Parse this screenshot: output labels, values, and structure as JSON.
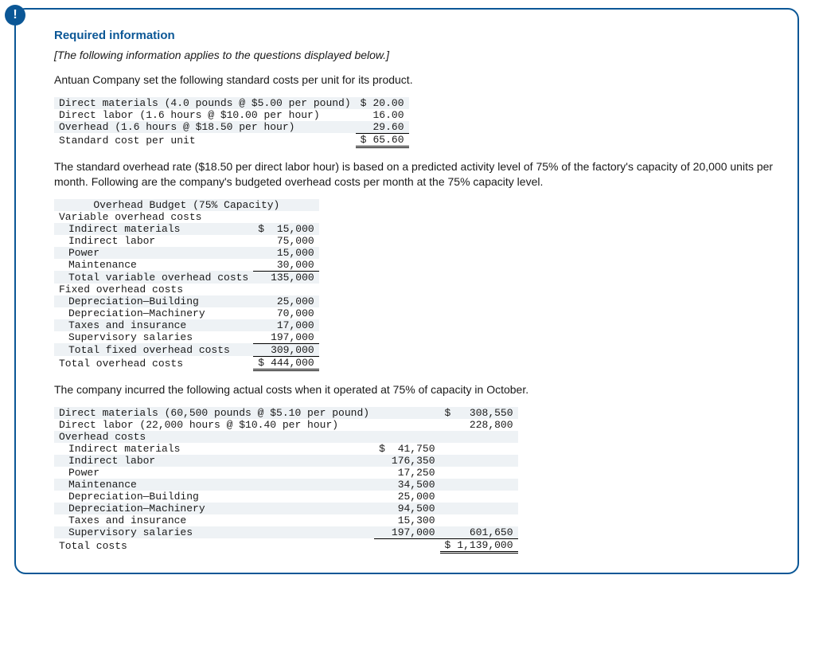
{
  "alert_glyph": "!",
  "title": "Required information",
  "italic_note": "[The following information applies to the questions displayed below.]",
  "intro": "Antuan Company set the following standard costs per unit for its product.",
  "std": {
    "rows": [
      {
        "label": "Direct materials (4.0 pounds @ $5.00 per pound)",
        "cur": "$",
        "val": "20.00"
      },
      {
        "label": "Direct labor (1.6 hours @ $10.00 per hour)",
        "cur": "",
        "val": "16.00"
      },
      {
        "label": "Overhead (1.6 hours @ $18.50 per hour)",
        "cur": "",
        "val": "29.60"
      }
    ],
    "total_label": "Standard cost per unit",
    "total_cur": "$",
    "total_val": "65.60"
  },
  "para2": "The standard overhead rate ($18.50 per direct labor hour) is based on a predicted activity level of 75% of the factory's capacity of 20,000 units per month. Following are the company's budgeted overhead costs per month at the 75% capacity level.",
  "budget": {
    "header": "Overhead Budget (75% Capacity)",
    "var_label": "Variable overhead costs",
    "var_rows": [
      {
        "label": "Indirect materials",
        "cur": "$",
        "val": "15,000"
      },
      {
        "label": "Indirect labor",
        "cur": "",
        "val": "75,000"
      },
      {
        "label": "Power",
        "cur": "",
        "val": "15,000"
      },
      {
        "label": "Maintenance",
        "cur": "",
        "val": "30,000"
      }
    ],
    "var_total_label": "Total variable overhead costs",
    "var_total_val": "135,000",
    "fix_label": "Fixed overhead costs",
    "fix_rows": [
      {
        "label": "Depreciation—Building",
        "val": "25,000"
      },
      {
        "label": "Depreciation—Machinery",
        "val": "70,000"
      },
      {
        "label": "Taxes and insurance",
        "val": "17,000"
      },
      {
        "label": "Supervisory salaries",
        "val": "197,000"
      }
    ],
    "fix_total_label": "Total fixed overhead costs",
    "fix_total_val": "309,000",
    "grand_label": "Total overhead costs",
    "grand_cur": "$",
    "grand_val": "444,000"
  },
  "para3": "The company incurred the following actual costs when it operated at 75% of capacity in October.",
  "actual": {
    "rows_top": [
      {
        "label": "Direct materials (60,500 pounds @ $5.10 per pound)",
        "cur": "$",
        "val": "308,550"
      },
      {
        "label": "Direct labor (22,000 hours @ $10.40 per hour)",
        "cur": "",
        "val": "228,800"
      }
    ],
    "oh_label": "Overhead costs",
    "oh_rows": [
      {
        "label": "Indirect materials",
        "cur": "$",
        "val": "41,750"
      },
      {
        "label": "Indirect labor",
        "cur": "",
        "val": "176,350"
      },
      {
        "label": "Power",
        "cur": "",
        "val": "17,250"
      },
      {
        "label": "Maintenance",
        "cur": "",
        "val": "34,500"
      },
      {
        "label": "Depreciation—Building",
        "cur": "",
        "val": "25,000"
      },
      {
        "label": "Depreciation—Machinery",
        "cur": "",
        "val": "94,500"
      },
      {
        "label": "Taxes and insurance",
        "cur": "",
        "val": "15,300"
      },
      {
        "label": "Supervisory salaries",
        "cur": "",
        "val": "197,000"
      }
    ],
    "oh_sum": "601,650",
    "total_label": "Total costs",
    "total_cur": "$",
    "total_val": "1,139,000"
  }
}
